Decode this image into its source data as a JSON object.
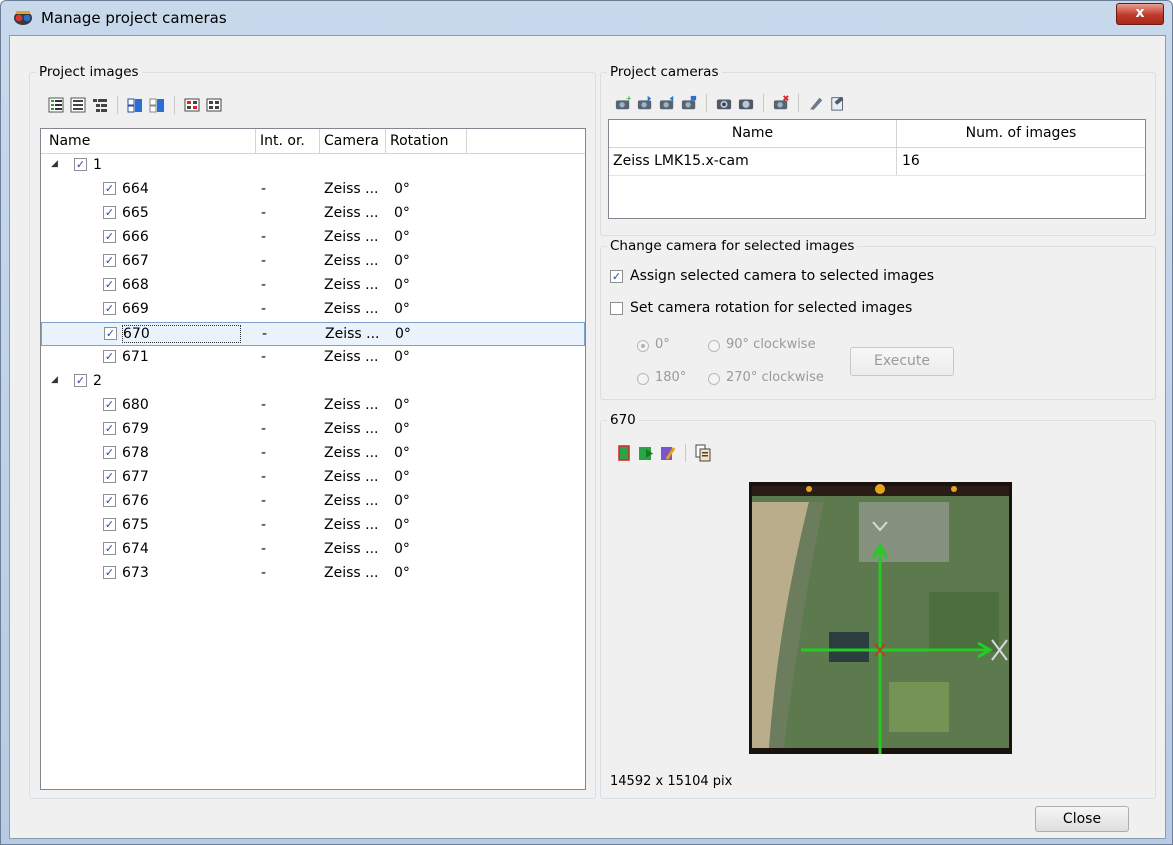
{
  "window": {
    "title": "Manage project cameras",
    "close_glyph": "x"
  },
  "project_images": {
    "group_label": "Project images",
    "columns": [
      "Name",
      "Int. or.",
      "Camera",
      "Rotation"
    ],
    "groups": [
      {
        "label": "1",
        "items": [
          {
            "name": "664",
            "int": "-",
            "camera": "Zeiss ...",
            "rot": "0°"
          },
          {
            "name": "665",
            "int": "-",
            "camera": "Zeiss ...",
            "rot": "0°"
          },
          {
            "name": "666",
            "int": "-",
            "camera": "Zeiss ...",
            "rot": "0°"
          },
          {
            "name": "667",
            "int": "-",
            "camera": "Zeiss ...",
            "rot": "0°"
          },
          {
            "name": "668",
            "int": "-",
            "camera": "Zeiss ...",
            "rot": "0°"
          },
          {
            "name": "669",
            "int": "-",
            "camera": "Zeiss ...",
            "rot": "0°"
          },
          {
            "name": "670",
            "int": "-",
            "camera": "Zeiss ...",
            "rot": "0°"
          },
          {
            "name": "671",
            "int": "-",
            "camera": "Zeiss ...",
            "rot": "0°"
          }
        ]
      },
      {
        "label": "2",
        "items": [
          {
            "name": "680",
            "int": "-",
            "camera": "Zeiss ...",
            "rot": "0°"
          },
          {
            "name": "679",
            "int": "-",
            "camera": "Zeiss ...",
            "rot": "0°"
          },
          {
            "name": "678",
            "int": "-",
            "camera": "Zeiss ...",
            "rot": "0°"
          },
          {
            "name": "677",
            "int": "-",
            "camera": "Zeiss ...",
            "rot": "0°"
          },
          {
            "name": "676",
            "int": "-",
            "camera": "Zeiss ...",
            "rot": "0°"
          },
          {
            "name": "675",
            "int": "-",
            "camera": "Zeiss ...",
            "rot": "0°"
          },
          {
            "name": "674",
            "int": "-",
            "camera": "Zeiss ...",
            "rot": "0°"
          },
          {
            "name": "673",
            "int": "-",
            "camera": "Zeiss ...",
            "rot": "0°"
          }
        ]
      }
    ]
  },
  "project_cameras": {
    "group_label": "Project cameras",
    "columns": [
      "Name",
      "Num. of images"
    ],
    "rows": [
      {
        "name": "Zeiss LMK15.x-cam",
        "count": "16"
      }
    ]
  },
  "change_camera": {
    "group_label": "Change camera for selected images",
    "assign_label": "Assign selected camera to selected images",
    "set_rotation_label": "Set camera rotation for selected images",
    "rot_0": "0°",
    "rot_90": "90° clockwise",
    "rot_180": "180°",
    "rot_270": "270° clockwise",
    "execute_label": "Execute"
  },
  "preview": {
    "group_label": "670",
    "size_text": "14592 x 15104 pix"
  },
  "footer": {
    "close_label": "Close"
  },
  "colors": {
    "accent_green": "#22cc22",
    "selection": "#eaf3fc",
    "title_close": "#c0392b"
  }
}
